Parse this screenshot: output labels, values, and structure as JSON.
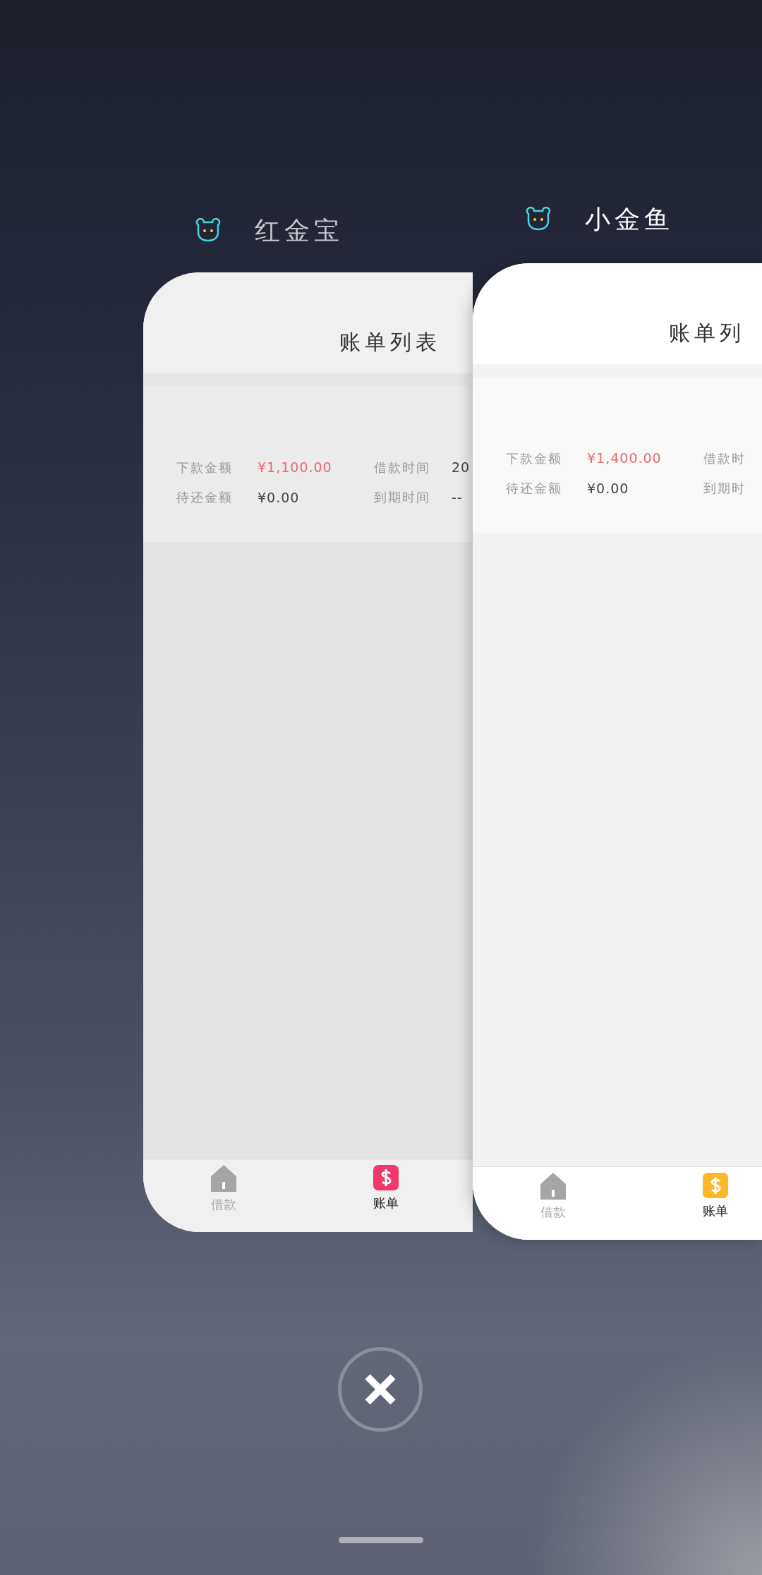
{
  "apps": [
    {
      "name": "红金宝",
      "selected": false,
      "color": "#f0386b",
      "screen": {
        "title": "账单列表",
        "rows": [
          [
            {
              "label": "下款金额",
              "value": "¥1,100.00",
              "accent": true
            },
            {
              "label": "借款时间",
              "value": "20",
              "accent": false
            }
          ],
          [
            {
              "label": "待还金额",
              "value": "¥0.00",
              "accent": false
            },
            {
              "label": "到期时间",
              "value": "--",
              "accent": false
            }
          ]
        ],
        "tabs": [
          {
            "label": "借款",
            "kind": "home",
            "selected": false
          },
          {
            "label": "账单",
            "kind": "bill",
            "selected": true
          }
        ]
      }
    },
    {
      "name": "小金鱼",
      "selected": true,
      "color": "#fbb829",
      "screen": {
        "title": "账单列",
        "rows": [
          [
            {
              "label": "下款金额",
              "value": "¥1,400.00",
              "accent": true
            },
            {
              "label": "借款时"
            }
          ],
          [
            {
              "label": "待还金额",
              "value": "¥0.00",
              "accent": false
            },
            {
              "label": "到期时"
            }
          ]
        ],
        "tabs": [
          {
            "label": "借款",
            "kind": "home",
            "selected": false
          },
          {
            "label": "账单",
            "kind": "bill",
            "selected": true
          }
        ]
      }
    }
  ]
}
